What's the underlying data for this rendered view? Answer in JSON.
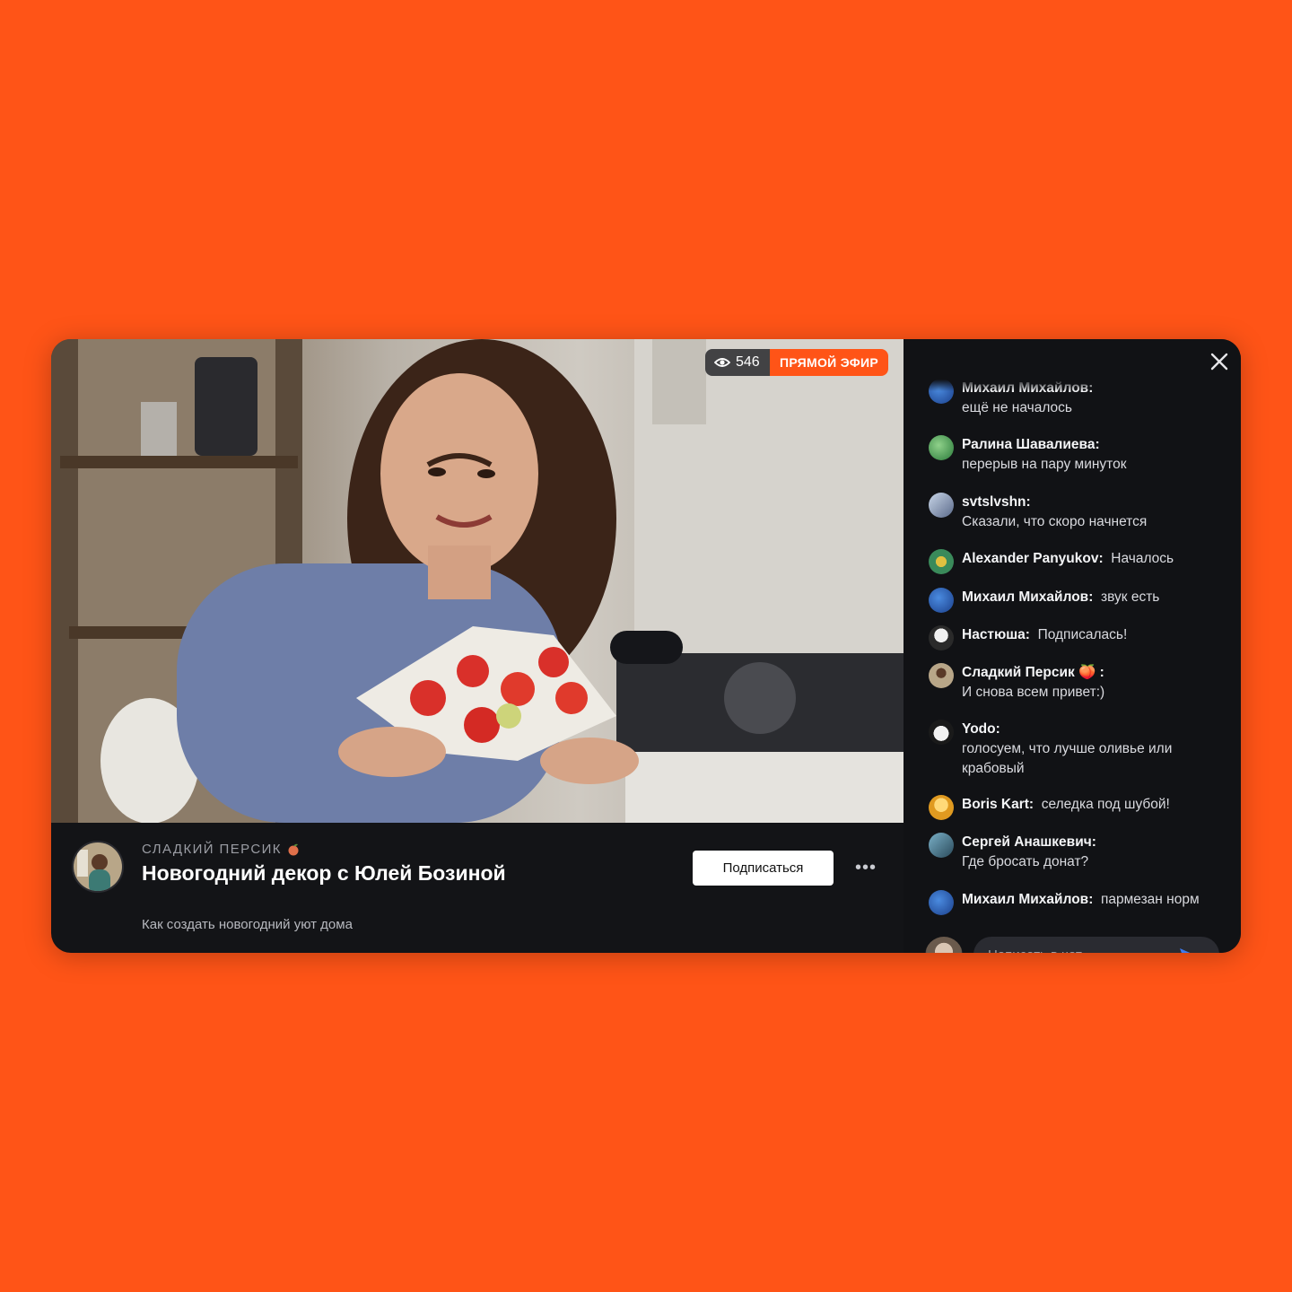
{
  "stream": {
    "views": "546",
    "live_label": "ПРЯМОЙ ЭФИР",
    "channel_name": "СЛАДКИЙ ПЕРСИК",
    "title": "Новогодний декор с Юлей Бозиной",
    "description": "Как создать новогодний уют дома",
    "subscribe_label": "Подписаться",
    "more_label": "•••"
  },
  "colors": {
    "accent": "#FF5417",
    "panel": "#131417"
  },
  "chat": {
    "messages": [
      {
        "author": "Михаил Михайлов:",
        "text": "ещё не началось",
        "avatar": "globe-avatar"
      },
      {
        "author": "Ралина Шавалиева:",
        "text": "перерыв на пару минуток",
        "avatar": "green-avatar"
      },
      {
        "author": "svtslvshn:",
        "text": "Сказали, что скоро начнется",
        "avatar": "photo-avatar"
      },
      {
        "author": "Alexander Panyukov:",
        "text": "Началось",
        "avatar": "mask-avatar"
      },
      {
        "author": "Михаил Михайлов:",
        "text": "звук есть",
        "avatar": "globe-avatar"
      },
      {
        "author": "Настюша:",
        "text": "Подписалась!",
        "avatar": "bw-avatar"
      },
      {
        "author": "Сладкий Персик 🍑 :",
        "text": "И снова всем привет:)",
        "avatar": "channel-avatar"
      },
      {
        "author": "Yodo:",
        "text": "голосуем, что лучше оливье или крабовый",
        "avatar": "cat-avatar"
      },
      {
        "author": "Boris Kart:",
        "text": "селедка под шубой!",
        "avatar": "yellow-avatar"
      },
      {
        "author": "Сергей Анашкевич:",
        "text": "Где бросать донат?",
        "avatar": "photo-avatar"
      },
      {
        "author": "Михаил Михайлов:",
        "text": "пармезан норм",
        "avatar": "globe-avatar"
      }
    ],
    "input_placeholder": "Написать в чат"
  },
  "icons": {
    "views": "eye-icon",
    "close": "close-icon",
    "send": "send-icon",
    "peach": "peach-icon"
  }
}
